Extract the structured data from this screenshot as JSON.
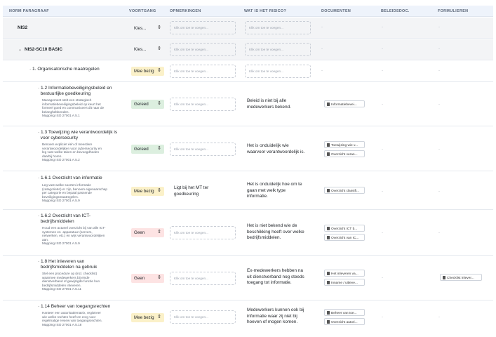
{
  "headers": [
    "NORM PARAGRAAF",
    "VOORTGANG",
    "OPMERKINGEN",
    "WAT IS HET RISICO?",
    "DOCUMENTEN",
    "BELEIDSDOC.",
    "FORMULIEREN"
  ],
  "placeholder": "Klik om toe te voegen...",
  "dash": "-",
  "icons": {
    "select_arrow": "updown-arrow-icon",
    "chip": "document-icon",
    "expand": "chevron-down-icon"
  },
  "status_colors": {
    "yellow": "#fbf1c9",
    "green": "#dcefdf",
    "pink": "#fde3e3"
  },
  "rows": [
    {
      "title": "NIS2",
      "status": "Kies...",
      "status_color": "none"
    },
    {
      "title": "NIS2-SC10 BASIC",
      "status": "Kies...",
      "status_color": "none"
    },
    {
      "title": "1. Organisatorische maatregelen",
      "status": "Mee bezig",
      "status_color": "yellow"
    },
    {
      "title": [
        "1.2 Informatiebeveiligingsbeleid en",
        "bestuurlijke goedkeuring"
      ],
      "desc": [
        "Management stelt een strategisch",
        "informatiebeveiligingsbeleid op keurt het",
        "formeel goed en communiceert dit naar de",
        "belanghebbenden."
      ],
      "mapping": "Mapping ISO 27001 A.5.1",
      "status": "Gereed",
      "status_color": "green",
      "risk": [
        "Beleid is niet bij alle",
        "medewerkers bekend."
      ],
      "docs": [
        "Informatiebevei..."
      ]
    },
    {
      "title": [
        "1.3 Toewijzing wie verantwoordelijk is",
        "voor cybersecurity"
      ],
      "desc": [
        "Benoem expliciet één of meerdere",
        "verantwoordelijken voor cybersecurity en",
        "leg vast welke taken en bevoegdheden",
        "daarbij horen."
      ],
      "mapping": "Mapping ISO 27001 A.5.2",
      "status": "Gereed",
      "status_color": "green",
      "risk": [
        "Het is onduidelijk wie",
        "waarvoor verantwoordelijk is."
      ],
      "docs": [
        "Toewijzing wie v...",
        "Overzicht veran..."
      ]
    },
    {
      "title": [
        "1.6.1 Overzicht van informatie"
      ],
      "desc": [
        "Leg vast welke soorten informatie",
        "(categorieën) er zijn, benoem eigenaarschap",
        "per categorie en bepaal passende",
        "beveiligingsmaatregelen."
      ],
      "mapping": "Mapping ISO 27001 A.5.9",
      "status": "Mee bezig",
      "status_color": "yellow",
      "note": [
        "Ligt bij het MT ter",
        "goedkeuring"
      ],
      "risk": [
        "Het is onduidelijk hoe om te",
        "gaan met welk type",
        "informatie."
      ],
      "docs": [
        "Overzicht classifi..."
      ]
    },
    {
      "title": [
        "1.6.2 Overzicht van ICT-",
        "bedrijfsmiddelen"
      ],
      "desc": [
        "Houd een actueel overzicht bij van alle ICT-",
        "systemen en -apparatuur (servers,",
        "netwerken, etc.) en wijs verantwoordelijken",
        "aan."
      ],
      "mapping": "Mapping ISO 27001 A.5.9",
      "status": "Geen",
      "status_color": "pink",
      "risk": [
        "Het is niet bekend wie de",
        "beschikking heeft over welke",
        "bedrijfsmiddelen."
      ],
      "docs": [
        "Overzicht ICT b...",
        "Overzicht van IC..."
      ]
    },
    {
      "title": [
        "1.8 Het inleveren van",
        "bedrijfsmiddelen na gebruik"
      ],
      "desc": [
        "Stel een procedure op (incl. checklist)",
        "waarmee medewerkers bij einde",
        "dienstverband of gewijzigde functie hun",
        "bedrijfsmiddelen inleveren."
      ],
      "mapping": "Mapping ISO 27001 A.5.11",
      "status": "Geen",
      "status_color": "pink",
      "risk": [
        "Ex-medewerkers hebben na",
        "uit dienstverband nog steeds",
        "toegang tot informatie."
      ],
      "docs": [
        "Het inleveren va...",
        "Inname / uitleve..."
      ],
      "forms": [
        "Checklist inlever..."
      ]
    },
    {
      "title": [
        "1.14 Beheer van toegangsrechten"
      ],
      "desc": [
        "Hanteer een autorisatiematrix, registreer",
        "wie welke rechten heeft en zorg voor",
        "regelmatige review van toegangsrechten."
      ],
      "mapping": "Mapping ISO 27001 A.5.18",
      "status": "Mee bezig",
      "status_color": "yellow",
      "risk": [
        "Medewerkers kunnen ook bij",
        "informatie waar zij niet bij",
        "hoeven of mogen komen."
      ],
      "docs": [
        "Beheer van toe...",
        "Overzicht autori..."
      ]
    }
  ]
}
